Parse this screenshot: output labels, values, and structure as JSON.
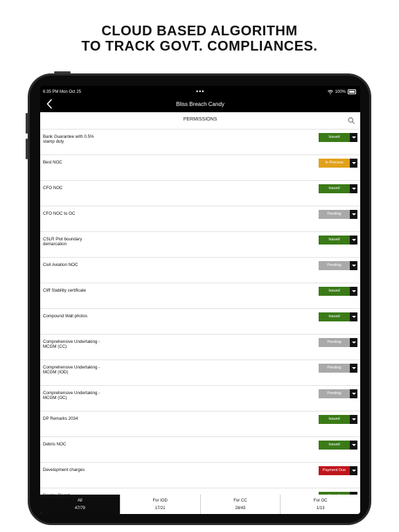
{
  "headline": {
    "line1": "CLOUD BASED ALGORITHM",
    "line2": "TO TRACK GOVT. COMPLIANCES."
  },
  "status_bar": {
    "time": "6:35 PM  Mon Oct 25",
    "dots": "•••",
    "battery": "100%"
  },
  "nav": {
    "title": "Bliss Breach Candy"
  },
  "section": {
    "title": "PERMISSIONS"
  },
  "colors": {
    "issued": "#3a7a17",
    "in_process": "#e0a11b",
    "pending": "#a9a9a9",
    "payment_due": "#c0151b"
  },
  "permissions": [
    {
      "name": "Bank Guarantee with 0.5% stamp duty",
      "status": "Issued",
      "kind": "issued"
    },
    {
      "name": "Best NOC",
      "status": "In Process",
      "kind": "in_process"
    },
    {
      "name": "CFO NOC",
      "status": "Issued",
      "kind": "issued"
    },
    {
      "name": "CFO NOC to OC",
      "status": "Pending",
      "kind": "pending"
    },
    {
      "name": "CSLR Plot boundary demarcation",
      "status": "Issued",
      "kind": "issued"
    },
    {
      "name": "Civil Aviation NOC",
      "status": "Pending",
      "kind": "pending"
    },
    {
      "name": "Cliff Stability certificate",
      "status": "Issued",
      "kind": "issued"
    },
    {
      "name": "Compound Wall photos",
      "status": "Issued",
      "kind": "issued"
    },
    {
      "name": "Comprehensive Undertaking - MCGM (CC)",
      "status": "Pending",
      "kind": "pending"
    },
    {
      "name": "Comprehensive Undertaking - MCGM (IOD)",
      "status": "Pending",
      "kind": "pending"
    },
    {
      "name": "Comprehensive Undertaking - MCGM (OC)",
      "status": "Pending",
      "kind": "pending"
    },
    {
      "name": "DP Remarks 2034",
      "status": "Issued",
      "kind": "issued"
    },
    {
      "name": "Debris NOC",
      "status": "Issued",
      "kind": "issued"
    },
    {
      "name": "Development charges",
      "status": "Payment Due",
      "kind": "payment_due"
    },
    {
      "name": "Display Board",
      "status": "Issued",
      "kind": "issued"
    }
  ],
  "tabs": [
    {
      "label": "All",
      "count": "47/79"
    },
    {
      "label": "For IOD",
      "count": "17/21"
    },
    {
      "label": "For CC",
      "count": "28/43"
    },
    {
      "label": "For OC",
      "count": "1/13"
    }
  ]
}
